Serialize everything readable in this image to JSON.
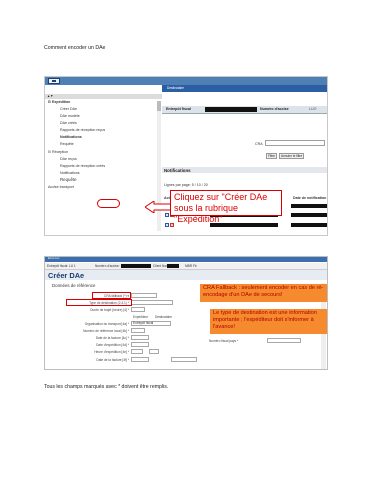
{
  "document": {
    "heading": "Comment encoder un DAe",
    "footer": "Tous les champs marqués avec * doivent être remplis."
  },
  "screenshot1": {
    "tab_label": "Destinataire",
    "nav": {
      "header": "▲▼",
      "items": [
        {
          "label": "⊟ Expédition",
          "bold": true
        },
        {
          "label": "Créer DAe"
        },
        {
          "label": "DAe modèle"
        },
        {
          "label": "DAe créés"
        },
        {
          "label": "Rapports de réception reçus"
        },
        {
          "label": "Notifications",
          "bold": true
        },
        {
          "label": "Requête"
        },
        {
          "label": "⊟ Réception"
        },
        {
          "label": "DAe reçus"
        },
        {
          "label": "Rapports de réception créés"
        },
        {
          "label": "Notifications"
        },
        {
          "label": "Requête",
          "large": true
        },
        {
          "label": "Accise transport"
        }
      ]
    },
    "info": {
      "entrepot_label": "Entrepôt fiscal",
      "accise_label": "Numéro d'accise",
      "accise_value": "LUO"
    },
    "annotation": "Cliquez sur \"Créer DAe sous la rubrique \"Expédition\"",
    "filters": {
      "cra_label": "CRA",
      "filter_button": "Filtre",
      "clear_button": "Annuler le filtre"
    },
    "notifications_title": "Notifications",
    "pagination": "Lignes par page: 5 / 10 / 20",
    "table_headers": [
      "Action",
      "Visualisation",
      "CRA - Séquence",
      "Date de notification"
    ]
  },
  "screenshot2": {
    "topbar": "Emcs Lux",
    "infobar": {
      "entrepot": "Entrepôt fiscal: LU 1",
      "accise": "Numéro d'accise:",
      "client": "Client Nom:",
      "etat": "MBR Fb"
    },
    "title": "Créer DAe",
    "section": "Données de référence",
    "fields": [
      {
        "label": "CRA fallback (*) ▾"
      },
      {
        "label": "Type de destination (2.4.1) *"
      },
      {
        "label": "Durée de trajet (heure) [4] *"
      },
      {
        "label": "Organisation du transport [4a] *"
      },
      {
        "label": "Numéro de référence local [4b] *"
      },
      {
        "label": "Date de la facture [4c] *"
      },
      {
        "label": "Date d'expédition [4d] *"
      },
      {
        "label": "Heure d'expédition [4e] *"
      },
      {
        "label": "Date de la facture [4f] *"
      }
    ],
    "radio_options": [
      "Expéditeur",
      "Destinataire",
      "Autre"
    ],
    "select_value": "Entrepôt fiscal",
    "numero_fiscal_label": "Numéro fiscal pays *",
    "annotation_a": "CRA Fallback : seulement encoder en cas de ré-encodage d'un DAe de secours!",
    "annotation_b": "Le type de destination est une information importante ; l'expéditeur doit s'informer à l'avance!"
  }
}
